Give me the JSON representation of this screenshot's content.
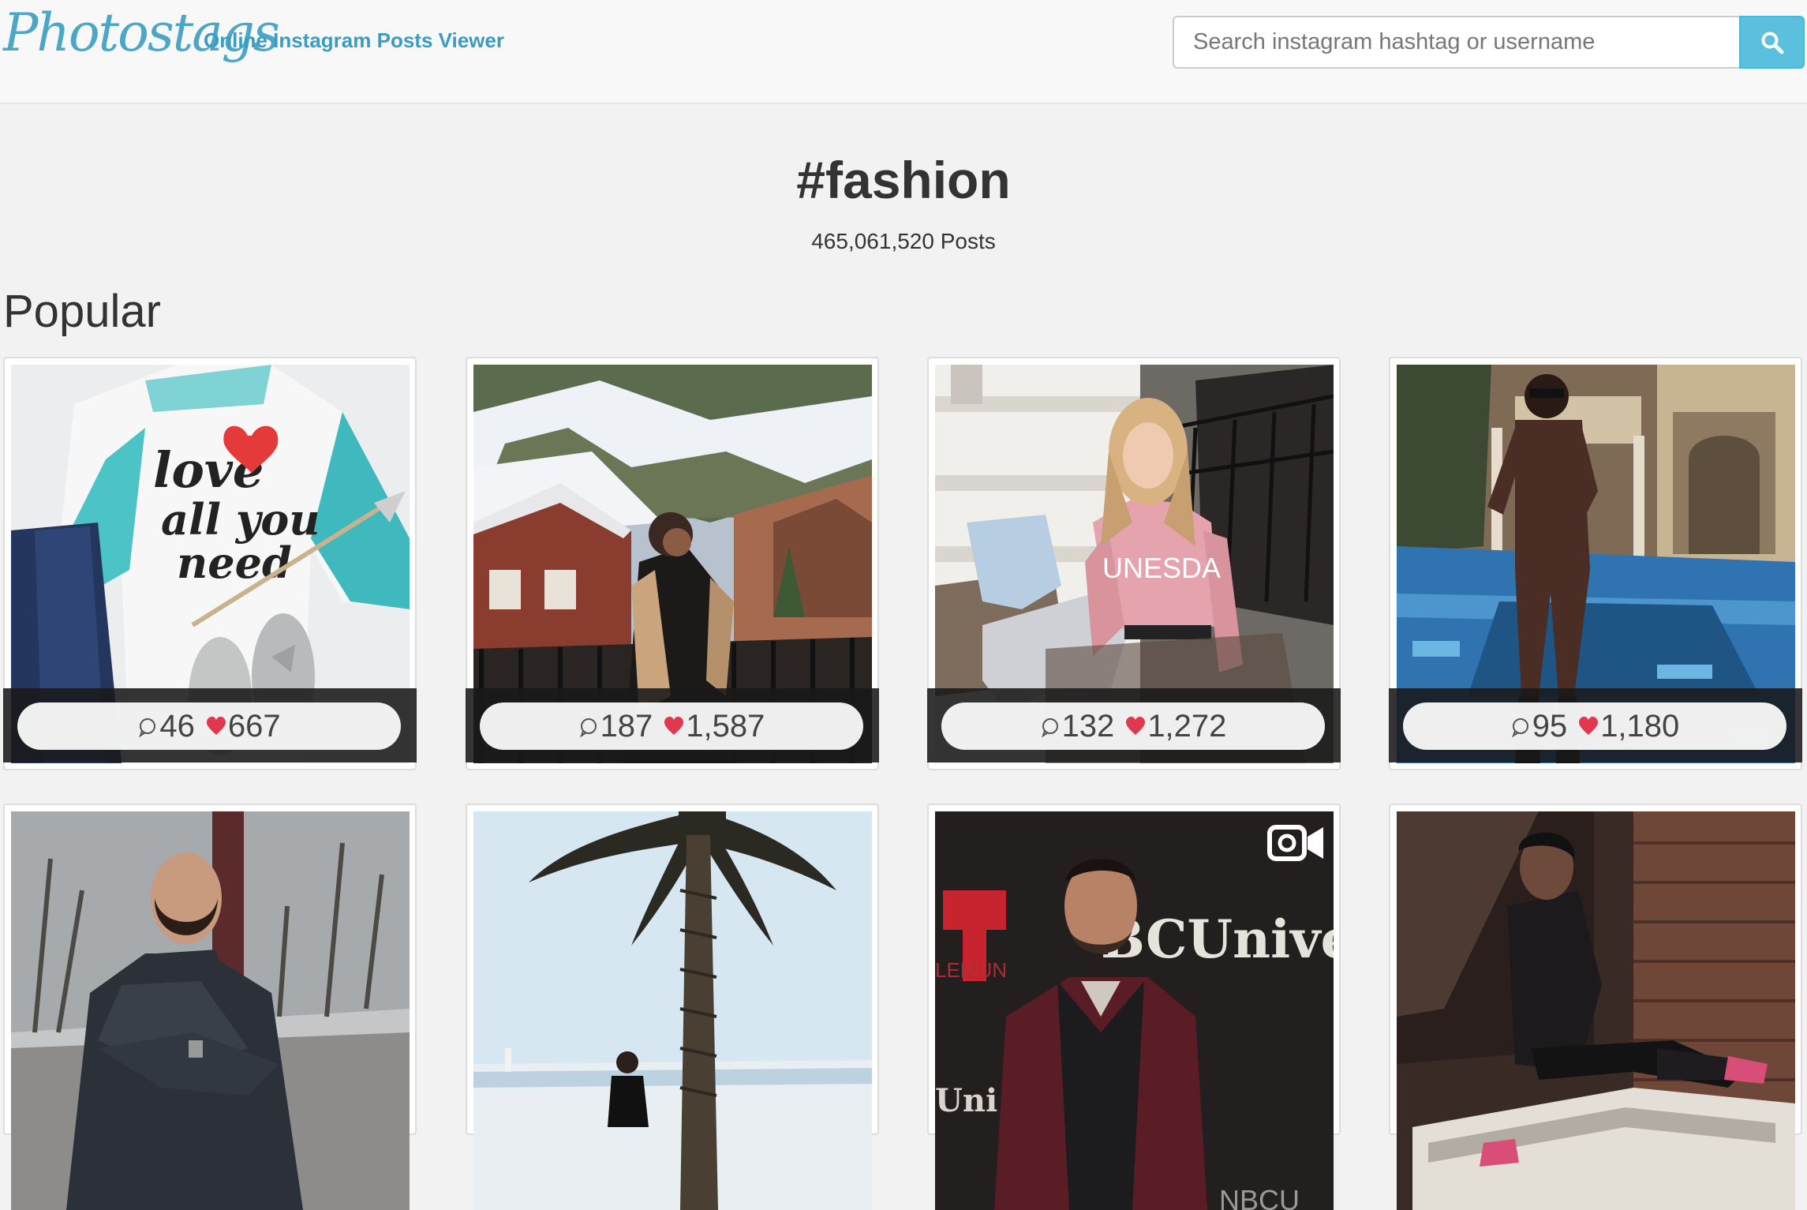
{
  "header": {
    "logo": "Photostags",
    "tagline": "Online Instagram Posts Viewer",
    "search_placeholder": "Search instagram hashtag or username"
  },
  "hashtag": {
    "title": "#fashion",
    "count": "465,061,520 Posts"
  },
  "section": "Popular",
  "colors": {
    "accent": "#5bc0de",
    "brand": "#4ca7c7",
    "heart": "#e0384f"
  },
  "posts": [
    {
      "comments": "46",
      "likes": "667",
      "video": false
    },
    {
      "comments": "187",
      "likes": "1,587",
      "video": false
    },
    {
      "comments": "132",
      "likes": "1,272",
      "video": false
    },
    {
      "comments": "95",
      "likes": "1,180",
      "video": false
    },
    {
      "video": false
    },
    {
      "video": false
    },
    {
      "video": true
    },
    {
      "video": false
    }
  ]
}
